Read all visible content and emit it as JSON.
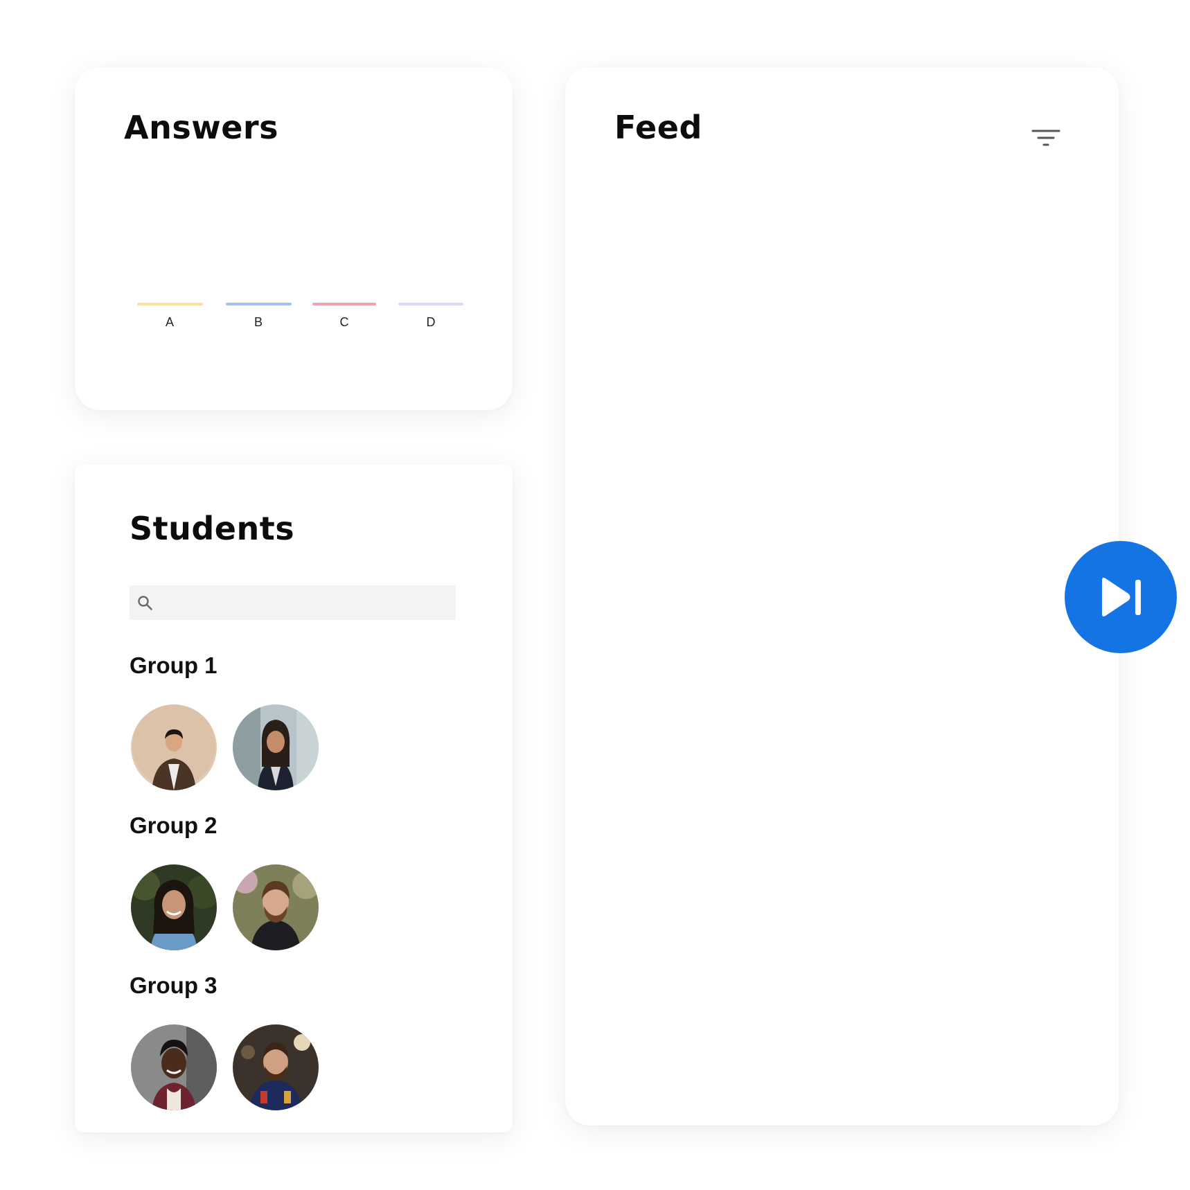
{
  "answers": {
    "title": "Answers",
    "chart_data": {
      "type": "bar",
      "categories": [
        "A",
        "B",
        "C",
        "D"
      ],
      "values": [
        0,
        0,
        0,
        0
      ],
      "colors": [
        "#f7e3a1",
        "#a9bff2",
        "#f2a3b3",
        "#ddd8f5"
      ]
    }
  },
  "students": {
    "title": "Students",
    "search": {
      "placeholder": "",
      "value": "",
      "icon": "search-icon"
    },
    "groups": [
      {
        "label": "Group 1"
      },
      {
        "label": "Group 2"
      },
      {
        "label": "Group 3"
      }
    ]
  },
  "feed": {
    "title": "Feed",
    "filter_icon": "filter-icon"
  },
  "next_button": {
    "icon": "skip-next-icon",
    "color": "#1474e4"
  }
}
